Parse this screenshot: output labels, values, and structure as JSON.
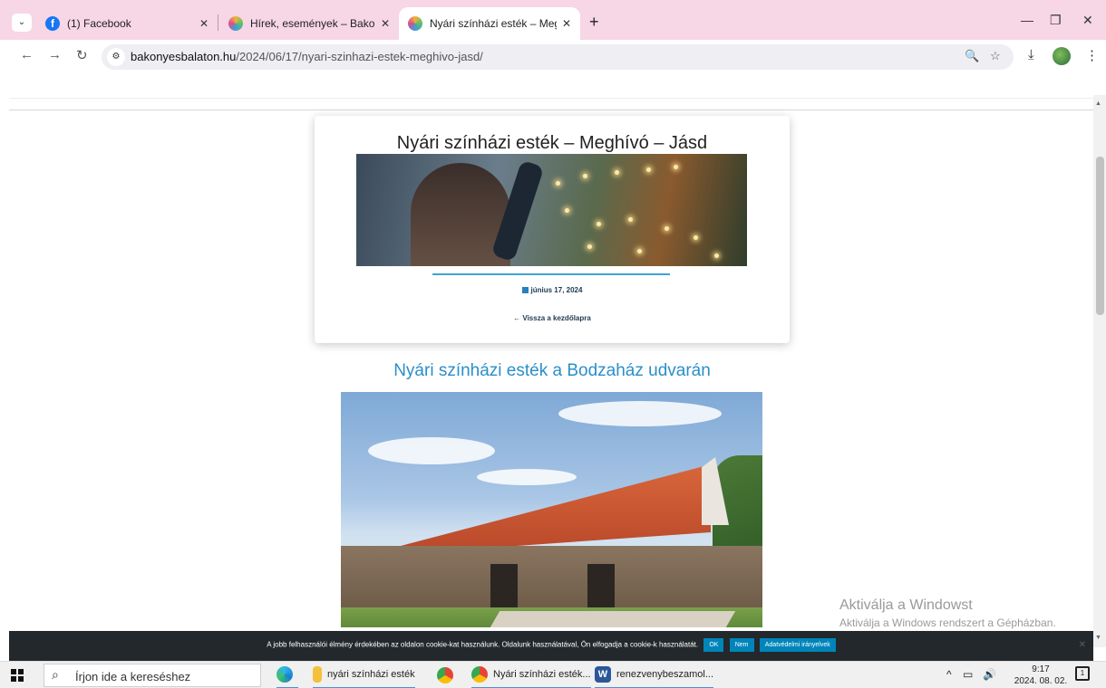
{
  "browser": {
    "tabs": [
      {
        "title": "(1) Facebook",
        "favicon": "facebook-icon",
        "active": false
      },
      {
        "title": "Hírek, események – Bakony és Balaton",
        "favicon": "bakony-balaton-icon",
        "active": false
      },
      {
        "title": "Nyári színházi esték – Meghívó – Jásd",
        "favicon": "bakony-balaton-icon",
        "active": true
      }
    ],
    "url_domain": "bakonyesbalaton.hu",
    "url_path": "/2024/06/17/nyari-szinhazi-estek-meghivo-jasd/"
  },
  "post": {
    "title": "Nyári színházi esték – Meghívó – Jásd",
    "date": "június 17, 2024",
    "back_link": "← Vissza a kezdőlapra",
    "article_title": "Nyári színházi esték a Bodzaház udvarán"
  },
  "watermark": {
    "line1": "Aktiválja a Windowst",
    "line2": "Aktiválja a Windows rendszert a Gépházban."
  },
  "cookie": {
    "text": "A jobb felhasználói élmény érdekében az oldalon cookie-kat használunk. Oldalunk használatával, Ön elfogadja a cookie-k használatát.",
    "ok": "OK",
    "no": "Nem",
    "policy": "Adatvédelmi irányelvek",
    "accent": "#0085ba"
  },
  "taskbar": {
    "search_placeholder": "Írjon ide a kereséshez",
    "apps": [
      {
        "label": "",
        "icon": "edge-icon"
      },
      {
        "label": "nyári színházi esték",
        "icon": "folder-icon"
      },
      {
        "label": "",
        "icon": "chrome-icon"
      },
      {
        "label": "Nyári színházi esték...",
        "icon": "chrome-icon"
      },
      {
        "label": "renezvenybeszamol...",
        "icon": "word-icon"
      }
    ],
    "time": "9:17",
    "date": "2024. 08. 02.",
    "notifications": "1"
  }
}
